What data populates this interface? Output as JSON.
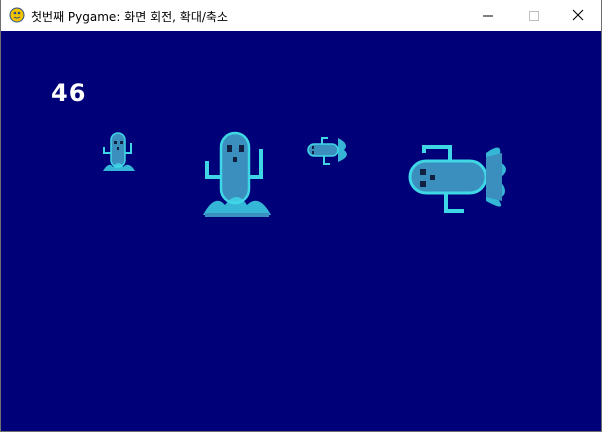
{
  "window": {
    "title": "첫번째 Pygame: 화면 회전, 확대/축소",
    "app_icon": "pygame-snake-icon",
    "controls": {
      "minimize_icon": "minimize-icon",
      "maximize_icon": "maximize-icon",
      "close_icon": "close-icon"
    }
  },
  "game": {
    "background_color": "#000078",
    "score": "46",
    "sprites": [
      {
        "name": "ghost-sprite-small",
        "icon": "ghost-icon",
        "rotation_deg": 0,
        "scale": "small"
      },
      {
        "name": "ghost-sprite-medium",
        "icon": "ghost-icon",
        "rotation_deg": 0,
        "scale": "medium"
      },
      {
        "name": "ghost-sprite-rotated-small",
        "icon": "ghost-icon",
        "rotation_deg": 90,
        "scale": "small"
      },
      {
        "name": "ghost-sprite-rotated-large",
        "icon": "ghost-icon",
        "rotation_deg": 90,
        "scale": "large"
      }
    ]
  },
  "colors": {
    "sprite_body": "#3a8fbf",
    "sprite_outline": "#3fd6e6",
    "sprite_eye": "#102040",
    "score_text": "#ffffff"
  }
}
